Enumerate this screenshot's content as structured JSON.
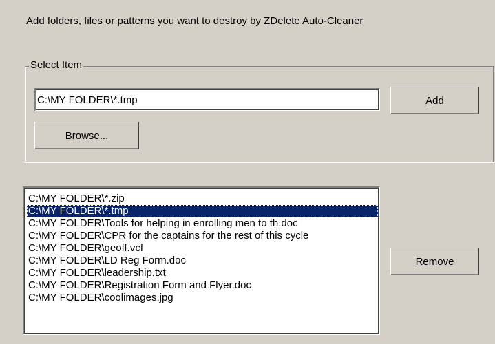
{
  "instruction": "Add folders, files or patterns you want to destroy by ZDelete Auto-Cleaner",
  "select_group": {
    "legend": "Select Item",
    "input_value": "C:\\MY FOLDER\\*.tmp",
    "add_button": {
      "label": "Add",
      "mnemonic": "A",
      "rest": "dd"
    },
    "browse_button": {
      "pre": "Bro",
      "mnemonic": "w",
      "post": "se..."
    }
  },
  "items_list": {
    "items": [
      "C:\\MY FOLDER\\*.zip",
      "C:\\MY FOLDER\\*.tmp",
      "C:\\MY FOLDER\\Tools for helping in enrolling men to th.doc",
      "C:\\MY FOLDER\\CPR for the captains for the rest of this cycle",
      "C:\\MY FOLDER\\geoff.vcf",
      "C:\\MY FOLDER\\LD Reg Form.doc",
      "C:\\MY FOLDER\\leadership.txt",
      "C:\\MY FOLDER\\Registration Form and Flyer.doc",
      "C:\\MY FOLDER\\coolimages.jpg"
    ],
    "selected_index": 1
  },
  "remove_button": {
    "mnemonic": "R",
    "rest": "emove"
  },
  "colors": {
    "window_bg": "#d4d0c8",
    "selection_bg": "#0a246a",
    "selection_text": "#ffffff"
  }
}
